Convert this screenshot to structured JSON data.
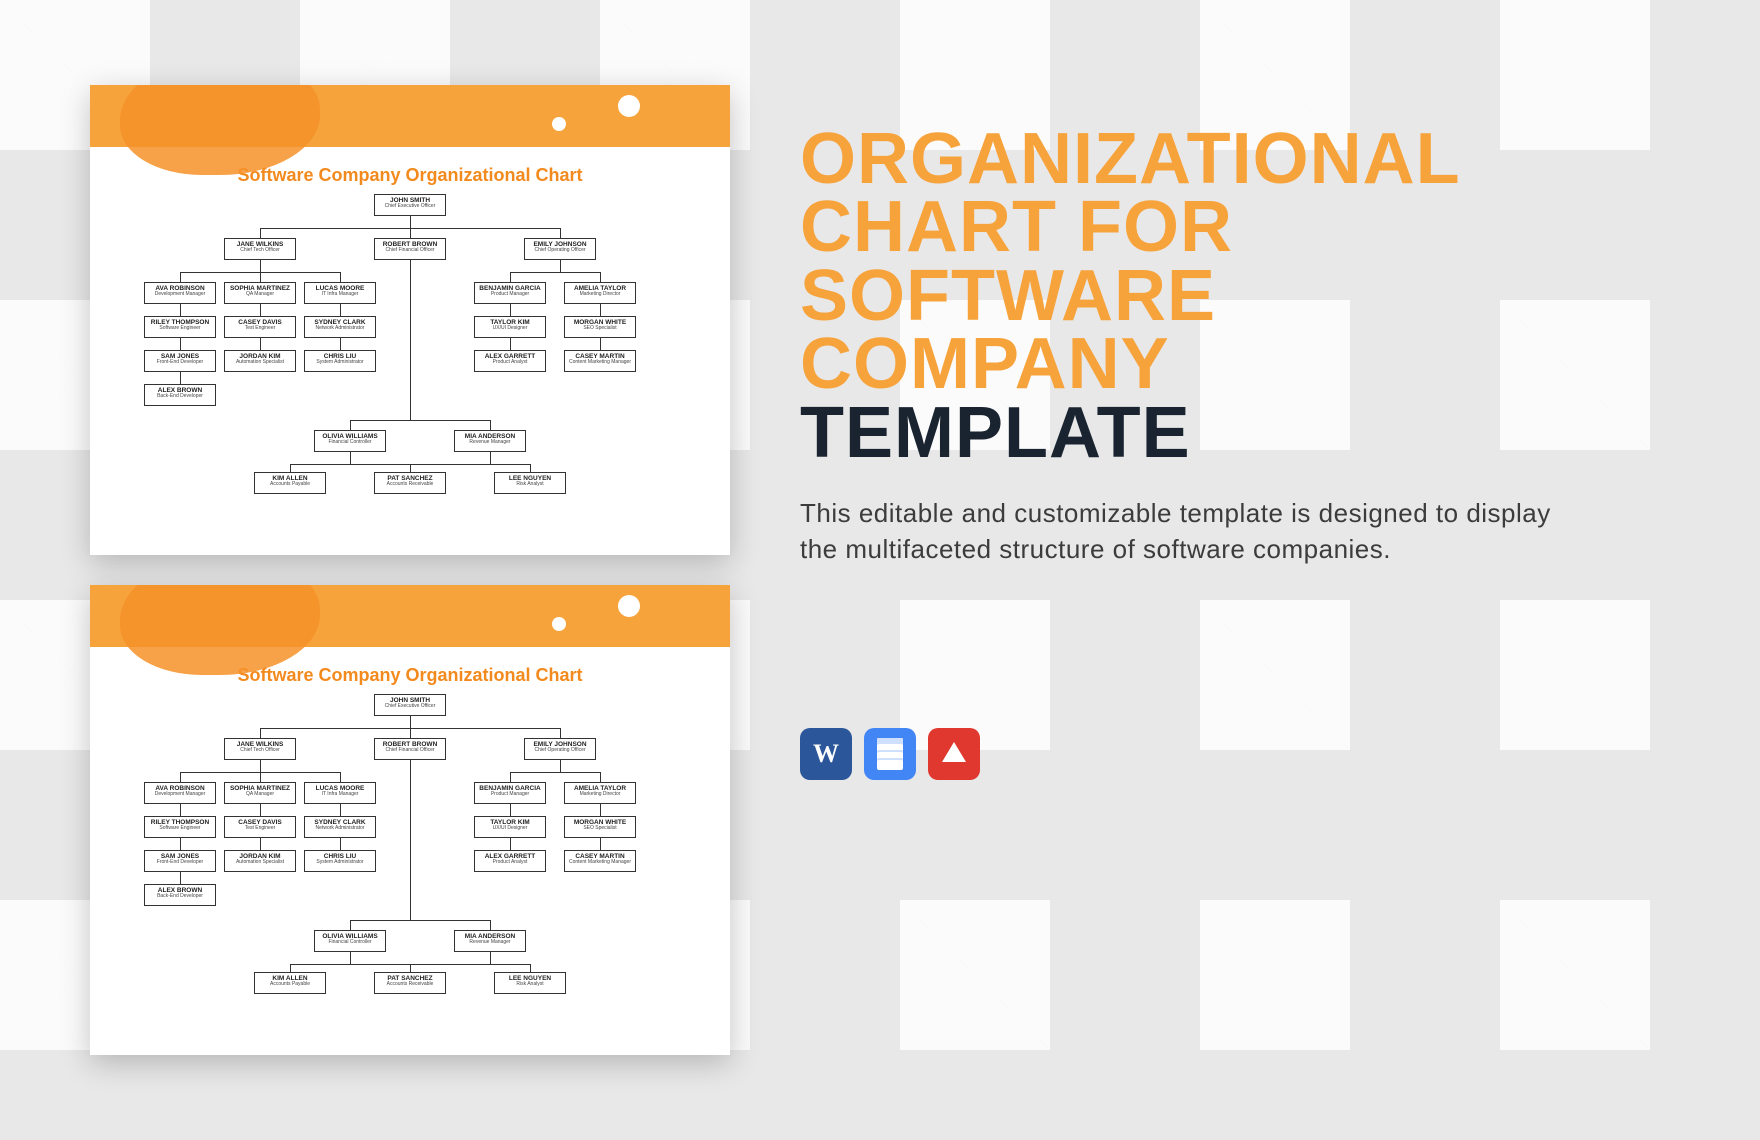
{
  "heading": {
    "line1": "ORGANIZATIONAL",
    "line2": "CHART FOR",
    "line3": "SOFTWARE",
    "line4": "COMPANY",
    "line5": "TEMPLATE"
  },
  "description": "This editable and customizable template is designed to display the multifaceted structure of software companies.",
  "slide_title": "Software Company Organizational Chart",
  "apps": [
    "Microsoft Word",
    "Google Docs",
    "Adobe PDF"
  ],
  "chart_data": {
    "type": "org-chart",
    "root": {
      "name": "JOHN SMITH",
      "title": "Chief Executive Officer"
    },
    "children": [
      {
        "name": "JANE WILKINS",
        "title": "Chief Tech Officer",
        "children": [
          {
            "name": "AVA ROBINSON",
            "title": "Development Manager",
            "children": [
              {
                "name": "RILEY THOMPSON",
                "title": "Software Engineer",
                "children": [
                  {
                    "name": "SAM JONES",
                    "title": "Front-End Developer",
                    "children": [
                      {
                        "name": "ALEX BROWN",
                        "title": "Back-End Developer"
                      }
                    ]
                  }
                ]
              }
            ]
          },
          {
            "name": "SOPHIA MARTINEZ",
            "title": "QA Manager",
            "children": [
              {
                "name": "CASEY DAVIS",
                "title": "Test Engineer",
                "children": [
                  {
                    "name": "JORDAN KIM",
                    "title": "Automation Specialist"
                  }
                ]
              }
            ]
          },
          {
            "name": "LUCAS MOORE",
            "title": "IT Infra Manager",
            "children": [
              {
                "name": "SYDNEY CLARK",
                "title": "Network Administrator",
                "children": [
                  {
                    "name": "CHRIS LIU",
                    "title": "System Administrator"
                  }
                ]
              }
            ]
          }
        ]
      },
      {
        "name": "ROBERT BROWN",
        "title": "Chief Financial Officer",
        "children": [
          {
            "name": "OLIVIA WILLIAMS",
            "title": "Financial Controller",
            "children": [
              {
                "name": "KIM ALLEN",
                "title": "Accounts Payable"
              },
              {
                "name": "PAT SANCHEZ",
                "title": "Accounts Receivable"
              }
            ]
          },
          {
            "name": "MIA ANDERSON",
            "title": "Revenue Manager",
            "children": [
              {
                "name": "LEE NGUYEN",
                "title": "Risk Analyst"
              }
            ]
          }
        ]
      },
      {
        "name": "EMILY JOHNSON",
        "title": "Chief Operating Officer",
        "children": [
          {
            "name": "BENJAMIN GARCIA",
            "title": "Product Manager",
            "children": [
              {
                "name": "TAYLOR KIM",
                "title": "UX/UI Designer",
                "children": [
                  {
                    "name": "ALEX GARRETT",
                    "title": "Product Analyst"
                  }
                ]
              }
            ]
          },
          {
            "name": "AMELIA TAYLOR",
            "title": "Marketing Director",
            "children": [
              {
                "name": "MORGAN WHITE",
                "title": "SEO Specialist",
                "children": [
                  {
                    "name": "CASEY MARTIN",
                    "title": "Content Marketing Manager"
                  }
                ]
              }
            ]
          }
        ]
      }
    ]
  }
}
